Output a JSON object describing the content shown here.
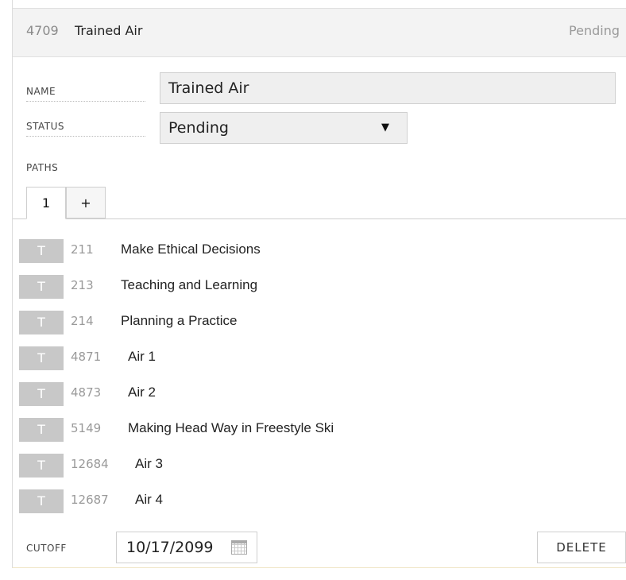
{
  "header": {
    "id": "4709",
    "title": "Trained Air",
    "status": "Pending"
  },
  "form": {
    "name_label": "NAME",
    "name_value": "Trained Air",
    "status_label": "STATUS",
    "status_value": "Pending",
    "status_arrow": "▼",
    "paths_label": "PATHS"
  },
  "tabs": [
    {
      "label": "1"
    },
    {
      "label": "+"
    }
  ],
  "items": [
    {
      "badge": "T",
      "num": "211",
      "name": "Make Ethical Decisions"
    },
    {
      "badge": "T",
      "num": "213",
      "name": "Teaching and Learning"
    },
    {
      "badge": "T",
      "num": "214",
      "name": "Planning a Practice"
    },
    {
      "badge": "T",
      "num": "4871",
      "name": "Air 1"
    },
    {
      "badge": "T",
      "num": "4873",
      "name": "Air 2"
    },
    {
      "badge": "T",
      "num": "5149",
      "name": "Making Head Way in Freestyle Ski"
    },
    {
      "badge": "T",
      "num": "12684",
      "name": "Air 3"
    },
    {
      "badge": "T",
      "num": "12687",
      "name": "Air 4"
    }
  ],
  "footer": {
    "cutoff_label": "CUTOFF",
    "cutoff_date": "10/17/2099",
    "delete_label": "DELETE"
  },
  "icons": {
    "calendar": "calendar-icon",
    "dropdown": "chevron-down-icon"
  }
}
